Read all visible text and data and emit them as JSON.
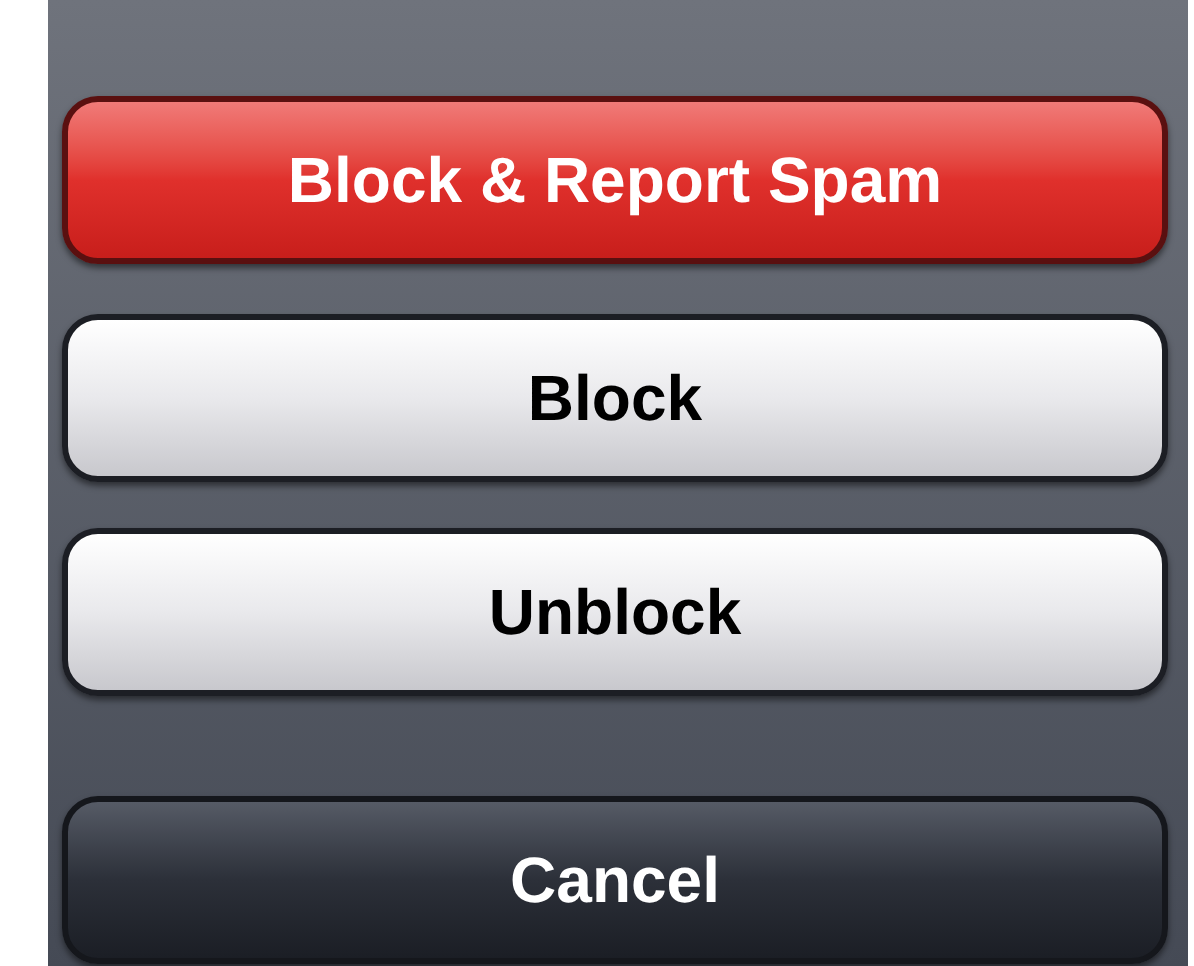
{
  "action_sheet": {
    "buttons": [
      {
        "label": "Block & Report Spam",
        "kind": "destructive"
      },
      {
        "label": "Block",
        "kind": "default"
      },
      {
        "label": "Unblock",
        "kind": "default"
      },
      {
        "label": "Cancel",
        "kind": "cancel"
      }
    ]
  }
}
